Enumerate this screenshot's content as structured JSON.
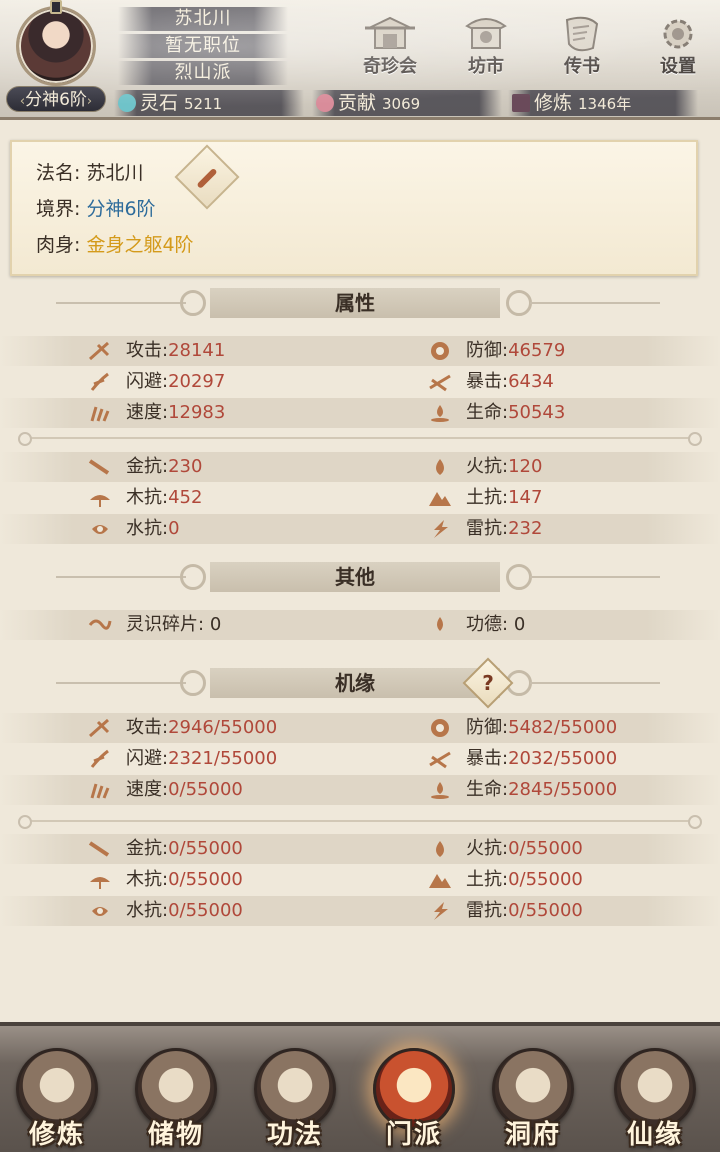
{
  "header": {
    "realm_tag": "分神6阶",
    "name_bars": [
      "苏北川",
      "暂无职位",
      "烈山派"
    ],
    "top_buttons": [
      {
        "label": "奇珍会",
        "icon": "treasure-pavilion-icon"
      },
      {
        "label": "坊市",
        "icon": "market-icon"
      },
      {
        "label": "传书",
        "icon": "scroll-letter-icon"
      },
      {
        "label": "设置",
        "icon": "gear-icon"
      }
    ],
    "resources": [
      {
        "label": "灵石",
        "value": "5211",
        "icon": "spirit-stone-icon",
        "color": "#6fc3c9"
      },
      {
        "label": "贡献",
        "value": "3069",
        "icon": "contribution-icon",
        "color": "#d98c9a"
      },
      {
        "label": "修炼",
        "value": "1346年",
        "icon": "cultivation-icon",
        "color": "#6a4a5a"
      }
    ]
  },
  "profile": {
    "dharma_name_label": "法名:",
    "dharma_name": "苏北川",
    "realm_label": "境界:",
    "realm": "分神6阶",
    "body_label": "肉身:",
    "body": "金身之躯4阶"
  },
  "sections": {
    "attributes": "属性",
    "other": "其他",
    "fortune": "机缘"
  },
  "attributes": {
    "left": [
      {
        "label": "攻击:",
        "value": "28141",
        "icon": "attack-icon"
      },
      {
        "label": "闪避:",
        "value": "20297",
        "icon": "dodge-icon"
      },
      {
        "label": "速度:",
        "value": "12983",
        "icon": "speed-icon"
      }
    ],
    "right": [
      {
        "label": "防御:",
        "value": "46579",
        "icon": "defense-icon"
      },
      {
        "label": "暴击:",
        "value": "6434",
        "icon": "critical-icon"
      },
      {
        "label": "生命:",
        "value": "50543",
        "icon": "life-icon"
      }
    ],
    "res_left": [
      {
        "label": "金抗:",
        "value": "230",
        "icon": "metal-resist-icon"
      },
      {
        "label": "木抗:",
        "value": "452",
        "icon": "wood-resist-icon"
      },
      {
        "label": "水抗:",
        "value": "0",
        "icon": "water-resist-icon"
      }
    ],
    "res_right": [
      {
        "label": "火抗:",
        "value": "120",
        "icon": "fire-resist-icon"
      },
      {
        "label": "土抗:",
        "value": "147",
        "icon": "earth-resist-icon"
      },
      {
        "label": "雷抗:",
        "value": "232",
        "icon": "thunder-resist-icon"
      }
    ]
  },
  "other": {
    "left": {
      "label": "灵识碎片:",
      "value": "0",
      "icon": "soul-fragment-icon"
    },
    "right": {
      "label": "功德:",
      "value": "0",
      "icon": "merit-icon"
    }
  },
  "fortune": {
    "help_label": "?",
    "left": [
      {
        "label": "攻击:",
        "value": "2946/55000"
      },
      {
        "label": "闪避:",
        "value": "2321/55000"
      },
      {
        "label": "速度:",
        "value": "0/55000"
      }
    ],
    "right": [
      {
        "label": "防御:",
        "value": "5482/55000"
      },
      {
        "label": "暴击:",
        "value": "2032/55000"
      },
      {
        "label": "生命:",
        "value": "2845/55000"
      }
    ],
    "res_left": [
      {
        "label": "金抗:",
        "value": "0/55000"
      },
      {
        "label": "木抗:",
        "value": "0/55000"
      },
      {
        "label": "水抗:",
        "value": "0/55000"
      }
    ],
    "res_right": [
      {
        "label": "火抗:",
        "value": "0/55000"
      },
      {
        "label": "土抗:",
        "value": "0/55000"
      },
      {
        "label": "雷抗:",
        "value": "0/55000"
      }
    ]
  },
  "bottom_nav": [
    {
      "label": "修炼",
      "icon": "cultivation-nav-icon",
      "active": false
    },
    {
      "label": "储物",
      "icon": "storage-bag-icon",
      "active": false
    },
    {
      "label": "功法",
      "icon": "technique-scroll-icon",
      "active": false
    },
    {
      "label": "门派",
      "icon": "sect-gate-icon",
      "active": true
    },
    {
      "label": "洞府",
      "icon": "cave-abode-icon",
      "active": false
    },
    {
      "label": "仙缘",
      "icon": "immortal-fate-icon",
      "active": false
    }
  ]
}
